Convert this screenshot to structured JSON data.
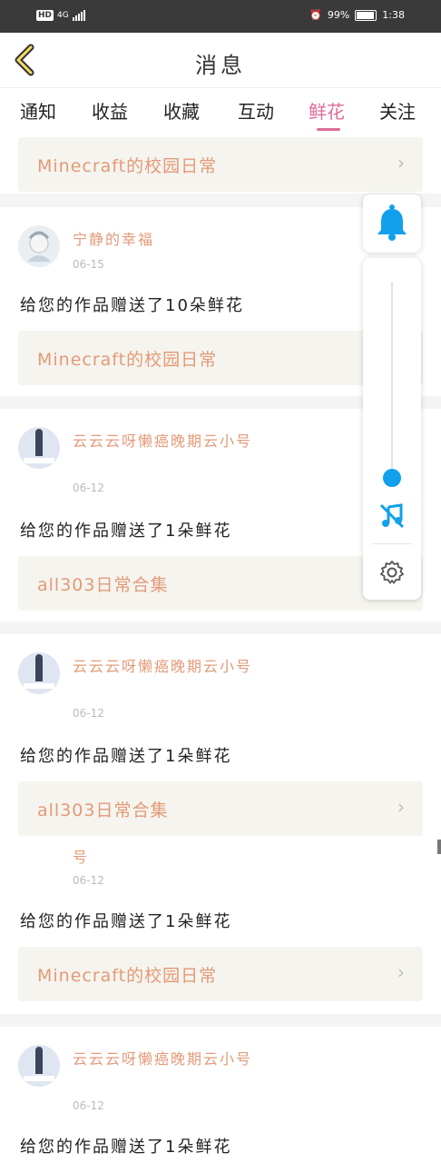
{
  "status_bar": {
    "network_badge": "HD",
    "network_type": "4G",
    "battery": "99%",
    "time": "1:38"
  },
  "header": {
    "title": "消息"
  },
  "tabs": [
    "通知",
    "收益",
    "收藏",
    "互动",
    "鲜花",
    "关注"
  ],
  "active_tab": "鲜花",
  "colors": {
    "accent": "#e06b98",
    "username": "#e39a78",
    "blue": "#12a0ec"
  },
  "items": [
    {
      "work_title": "Minecraft的校园日常"
    },
    {
      "username": "宁静的幸福",
      "date": "06-15",
      "message": "给您的作品赠送了10朵鲜花",
      "work_title": "Minecraft的校园日常"
    },
    {
      "username": "云云云呀懒癌晚期云小号",
      "date": "06-12",
      "message": "给您的作品赠送了1朵鲜花",
      "work_title": "all303日常合集"
    },
    {
      "username": "云云云呀懒癌晚期云小号",
      "date": "06-12",
      "message": "给您的作品赠送了1朵鲜花",
      "work_title": "all303日常合集"
    },
    {
      "username_tail": "号",
      "date": "06-12",
      "message": "给您的作品赠送了1朵鲜花",
      "work_title": "Minecraft的校园日常"
    },
    {
      "username": "云云云呀懒癌晚期云小号",
      "date": "06-12",
      "message": "给您的作品赠送了1朵鲜花"
    }
  ],
  "floating": {
    "icons": [
      "bell-icon",
      "music-off-icon",
      "gear-icon"
    ],
    "volume_level": 0.1
  }
}
